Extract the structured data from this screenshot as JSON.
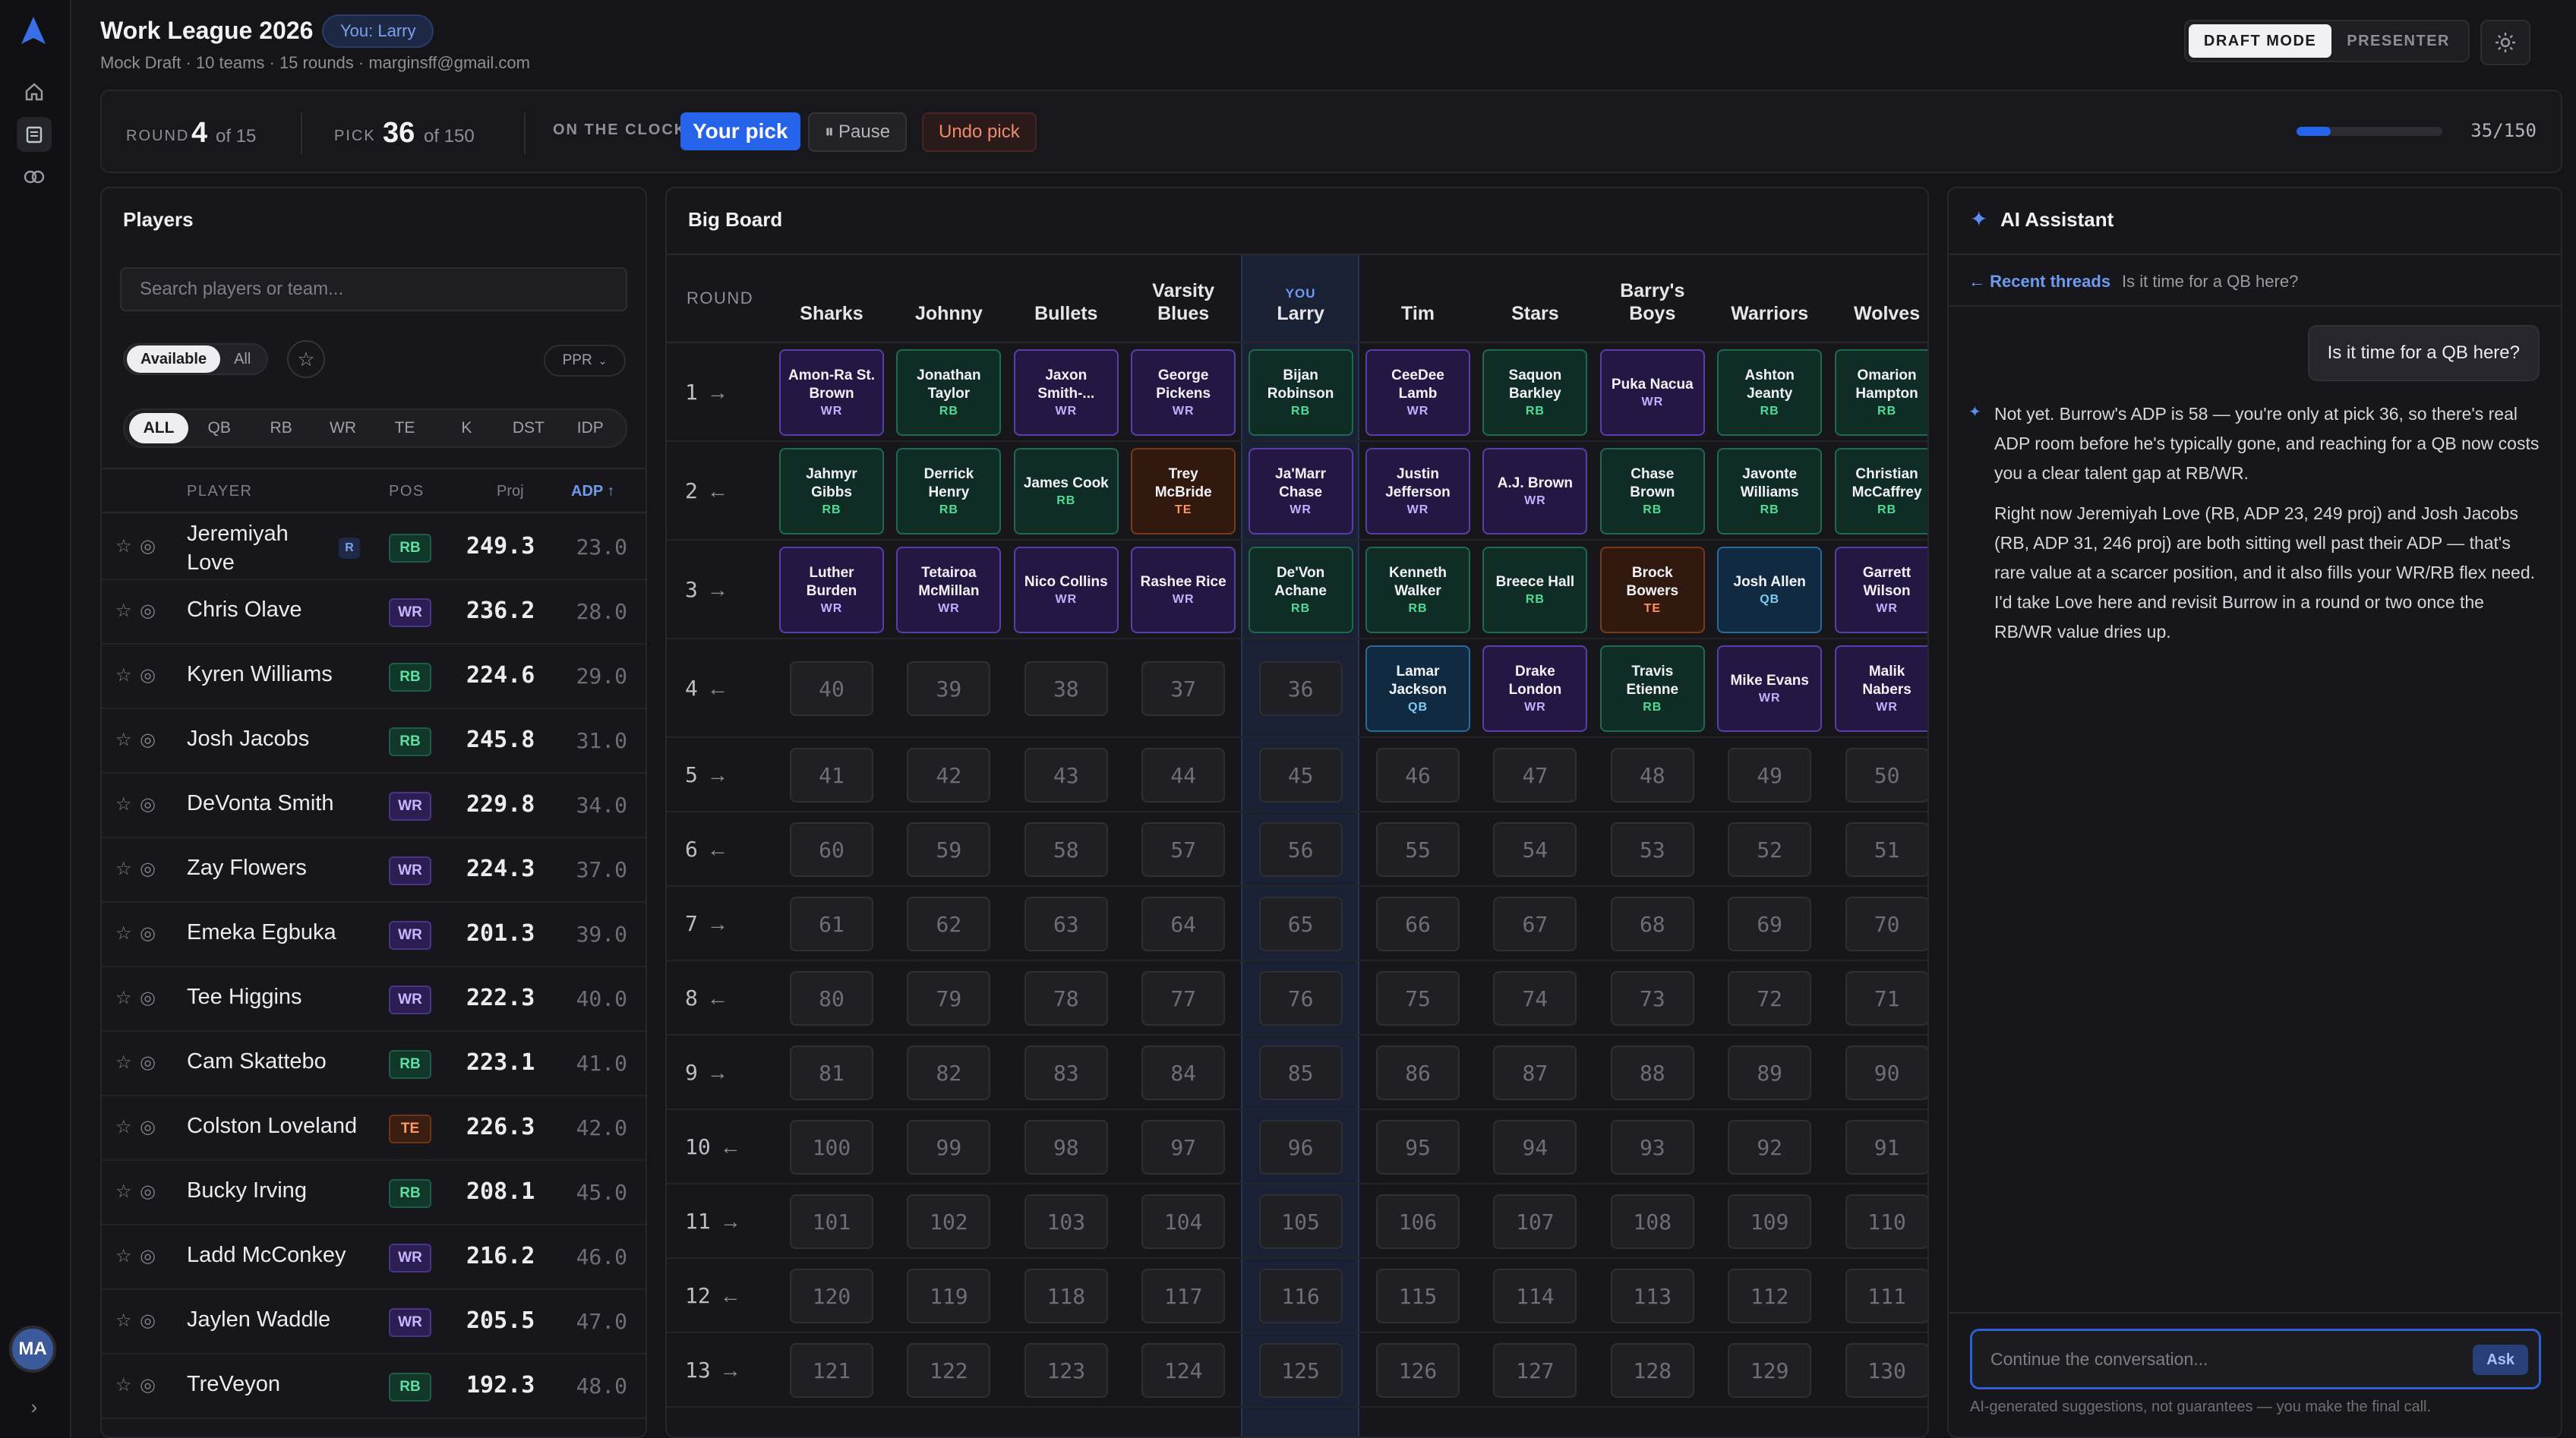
{
  "app": {
    "title": "Work League 2026",
    "you_badge": "You: Larry",
    "subtitle": "Mock Draft · 10 teams · 15 rounds · marginsff@gmail.com",
    "avatar": "MA",
    "modes": [
      "DRAFT MODE",
      "PRESENTER"
    ],
    "active_mode": "DRAFT MODE"
  },
  "status": {
    "round_label": "ROUND",
    "round": "4",
    "round_of": "of 15",
    "pick_label": "PICK",
    "pick": "36",
    "pick_of": "of 150",
    "clock_label": "ON THE CLOCK",
    "your_pick": "Your pick",
    "pause": "Pause",
    "undo": "Undo pick",
    "progress": 0.2333,
    "progress_text": "35/150"
  },
  "players": {
    "title": "Players",
    "search_placeholder": "Search players or team...",
    "filter": [
      "Available",
      "All"
    ],
    "scoring": "PPR",
    "positions": [
      "ALL",
      "QB",
      "RB",
      "WR",
      "TE",
      "K",
      "DST",
      "IDP"
    ],
    "headers": {
      "player": "PLAYER",
      "pos": "POS",
      "proj": "Proj",
      "adp": "ADP ↑"
    },
    "rows": [
      {
        "name": "Jeremiyah\nLove",
        "rookie": "R",
        "pos": "RB",
        "proj": "249.3",
        "adp": "23.0"
      },
      {
        "name": "Chris Olave",
        "pos": "WR",
        "proj": "236.2",
        "adp": "28.0"
      },
      {
        "name": "Kyren Williams",
        "pos": "RB",
        "proj": "224.6",
        "adp": "29.0"
      },
      {
        "name": "Josh Jacobs",
        "pos": "RB",
        "proj": "245.8",
        "adp": "31.0"
      },
      {
        "name": "DeVonta Smith",
        "pos": "WR",
        "proj": "229.8",
        "adp": "34.0"
      },
      {
        "name": "Zay Flowers",
        "pos": "WR",
        "proj": "224.3",
        "adp": "37.0"
      },
      {
        "name": "Emeka Egbuka",
        "pos": "WR",
        "proj": "201.3",
        "adp": "39.0"
      },
      {
        "name": "Tee Higgins",
        "pos": "WR",
        "proj": "222.3",
        "adp": "40.0"
      },
      {
        "name": "Cam Skattebo",
        "pos": "RB",
        "proj": "223.1",
        "adp": "41.0"
      },
      {
        "name": "Colston Loveland",
        "pos": "TE",
        "proj": "226.3",
        "adp": "42.0"
      },
      {
        "name": "Bucky Irving",
        "pos": "RB",
        "proj": "208.1",
        "adp": "45.0"
      },
      {
        "name": "Ladd McConkey",
        "pos": "WR",
        "proj": "216.2",
        "adp": "46.0"
      },
      {
        "name": "Jaylen Waddle",
        "pos": "WR",
        "proj": "205.5",
        "adp": "47.0"
      },
      {
        "name": "TreVeyon",
        "pos": "RB",
        "proj": "192.3",
        "adp": "48.0"
      }
    ]
  },
  "board": {
    "title": "Big Board",
    "round_header": "ROUND",
    "you_label": "YOU",
    "you_team_index": 4,
    "teams": [
      "Sharks",
      "Johnny",
      "Bullets",
      "Varsity\nBlues",
      "Larry",
      "Tim",
      "Stars",
      "Barry's\nBoys",
      "Warriors",
      "Wolves"
    ],
    "rounds": [
      {
        "label": "1",
        "arrow": "→",
        "picks": [
          {
            "name": "Amon-Ra St.\nBrown",
            "pos": "WR"
          },
          {
            "name": "Jonathan\nTaylor",
            "pos": "RB"
          },
          {
            "name": "Jaxon\nSmith-...",
            "pos": "WR"
          },
          {
            "name": "George\nPickens",
            "pos": "WR"
          },
          {
            "name": "Bijan\nRobinson",
            "pos": "RB"
          },
          {
            "name": "CeeDee\nLamb",
            "pos": "WR"
          },
          {
            "name": "Saquon\nBarkley",
            "pos": "RB"
          },
          {
            "name": "Puka Nacua",
            "pos": "WR"
          },
          {
            "name": "Ashton\nJeanty",
            "pos": "RB"
          },
          {
            "name": "Omarion\nHampton",
            "pos": "RB"
          }
        ]
      },
      {
        "label": "2",
        "arrow": "←",
        "picks": [
          {
            "name": "Jahmyr\nGibbs",
            "pos": "RB"
          },
          {
            "name": "Derrick\nHenry",
            "pos": "RB"
          },
          {
            "name": "James Cook",
            "pos": "RB"
          },
          {
            "name": "Trey\nMcBride",
            "pos": "TE"
          },
          {
            "name": "Ja'Marr\nChase",
            "pos": "WR"
          },
          {
            "name": "Justin\nJefferson",
            "pos": "WR"
          },
          {
            "name": "A.J. Brown",
            "pos": "WR"
          },
          {
            "name": "Chase\nBrown",
            "pos": "RB"
          },
          {
            "name": "Javonte\nWilliams",
            "pos": "RB"
          },
          {
            "name": "Christian\nMcCaffrey",
            "pos": "RB"
          }
        ]
      },
      {
        "label": "3",
        "arrow": "→",
        "picks": [
          {
            "name": "Luther\nBurden",
            "pos": "WR"
          },
          {
            "name": "Tetairoa\nMcMillan",
            "pos": "WR"
          },
          {
            "name": "Nico Collins",
            "pos": "WR"
          },
          {
            "name": "Rashee Rice",
            "pos": "WR"
          },
          {
            "name": "De'Von\nAchane",
            "pos": "RB"
          },
          {
            "name": "Kenneth\nWalker",
            "pos": "RB"
          },
          {
            "name": "Breece Hall",
            "pos": "RB"
          },
          {
            "name": "Brock\nBowers",
            "pos": "TE"
          },
          {
            "name": "Josh Allen",
            "pos": "QB"
          },
          {
            "name": "Garrett\nWilson",
            "pos": "WR"
          }
        ]
      },
      {
        "label": "4",
        "arrow": "←",
        "picks": [
          {
            "num": "40"
          },
          {
            "num": "39"
          },
          {
            "num": "38"
          },
          {
            "num": "37"
          },
          {
            "num": "36"
          },
          {
            "name": "Lamar\nJackson",
            "pos": "QB"
          },
          {
            "name": "Drake\nLondon",
            "pos": "WR"
          },
          {
            "name": "Travis\nEtienne",
            "pos": "RB"
          },
          {
            "name": "Mike Evans",
            "pos": "WR"
          },
          {
            "name": "Malik\nNabers",
            "pos": "WR"
          }
        ]
      },
      {
        "label": "5",
        "arrow": "→",
        "picks": [
          {
            "num": "41"
          },
          {
            "num": "42"
          },
          {
            "num": "43"
          },
          {
            "num": "44"
          },
          {
            "num": "45"
          },
          {
            "num": "46"
          },
          {
            "num": "47"
          },
          {
            "num": "48"
          },
          {
            "num": "49"
          },
          {
            "num": "50"
          }
        ]
      },
      {
        "label": "6",
        "arrow": "←",
        "picks": [
          {
            "num": "60"
          },
          {
            "num": "59"
          },
          {
            "num": "58"
          },
          {
            "num": "57"
          },
          {
            "num": "56"
          },
          {
            "num": "55"
          },
          {
            "num": "54"
          },
          {
            "num": "53"
          },
          {
            "num": "52"
          },
          {
            "num": "51"
          }
        ]
      },
      {
        "label": "7",
        "arrow": "→",
        "picks": [
          {
            "num": "61"
          },
          {
            "num": "62"
          },
          {
            "num": "63"
          },
          {
            "num": "64"
          },
          {
            "num": "65"
          },
          {
            "num": "66"
          },
          {
            "num": "67"
          },
          {
            "num": "68"
          },
          {
            "num": "69"
          },
          {
            "num": "70"
          }
        ]
      },
      {
        "label": "8",
        "arrow": "←",
        "picks": [
          {
            "num": "80"
          },
          {
            "num": "79"
          },
          {
            "num": "78"
          },
          {
            "num": "77"
          },
          {
            "num": "76"
          },
          {
            "num": "75"
          },
          {
            "num": "74"
          },
          {
            "num": "73"
          },
          {
            "num": "72"
          },
          {
            "num": "71"
          }
        ]
      },
      {
        "label": "9",
        "arrow": "→",
        "picks": [
          {
            "num": "81"
          },
          {
            "num": "82"
          },
          {
            "num": "83"
          },
          {
            "num": "84"
          },
          {
            "num": "85"
          },
          {
            "num": "86"
          },
          {
            "num": "87"
          },
          {
            "num": "88"
          },
          {
            "num": "89"
          },
          {
            "num": "90"
          }
        ]
      },
      {
        "label": "10",
        "arrow": "←",
        "picks": [
          {
            "num": "100"
          },
          {
            "num": "99"
          },
          {
            "num": "98"
          },
          {
            "num": "97"
          },
          {
            "num": "96"
          },
          {
            "num": "95"
          },
          {
            "num": "94"
          },
          {
            "num": "93"
          },
          {
            "num": "92"
          },
          {
            "num": "91"
          }
        ]
      },
      {
        "label": "11",
        "arrow": "→",
        "picks": [
          {
            "num": "101"
          },
          {
            "num": "102"
          },
          {
            "num": "103"
          },
          {
            "num": "104"
          },
          {
            "num": "105"
          },
          {
            "num": "106"
          },
          {
            "num": "107"
          },
          {
            "num": "108"
          },
          {
            "num": "109"
          },
          {
            "num": "110"
          }
        ]
      },
      {
        "label": "12",
        "arrow": "←",
        "picks": [
          {
            "num": "120"
          },
          {
            "num": "119"
          },
          {
            "num": "118"
          },
          {
            "num": "117"
          },
          {
            "num": "116"
          },
          {
            "num": "115"
          },
          {
            "num": "114"
          },
          {
            "num": "113"
          },
          {
            "num": "112"
          },
          {
            "num": "111"
          }
        ]
      },
      {
        "label": "13",
        "arrow": "→",
        "picks": [
          {
            "num": "121"
          },
          {
            "num": "122"
          },
          {
            "num": "123"
          },
          {
            "num": "124"
          },
          {
            "num": "125"
          },
          {
            "num": "126"
          },
          {
            "num": "127"
          },
          {
            "num": "128"
          },
          {
            "num": "129"
          },
          {
            "num": "130"
          }
        ]
      }
    ]
  },
  "ai": {
    "title": "AI Assistant",
    "back_link": "← Recent threads",
    "current_thread": "Is it time for a QB here?",
    "user_message": "Is it time for a QB here?",
    "reply": [
      "Not yet. Burrow's ADP is 58 — you're only at pick 36, so there's real ADP room before he's typically gone, and reaching for a QB now costs you a clear talent gap at RB/WR.",
      "Right now Jeremiyah Love (RB, ADP 23, 249 proj) and Josh Jacobs (RB, ADP 31, 246 proj) are both sitting well past their ADP — that's rare value at a scarcer position, and it also fills your WR/RB flex need. I'd take Love here and revisit Burrow in a round or two once the RB/WR value dries up."
    ],
    "input_placeholder": "Continue the conversation...",
    "ask": "Ask",
    "disclaimer": "AI-generated suggestions, not guarantees — you make the final call."
  }
}
